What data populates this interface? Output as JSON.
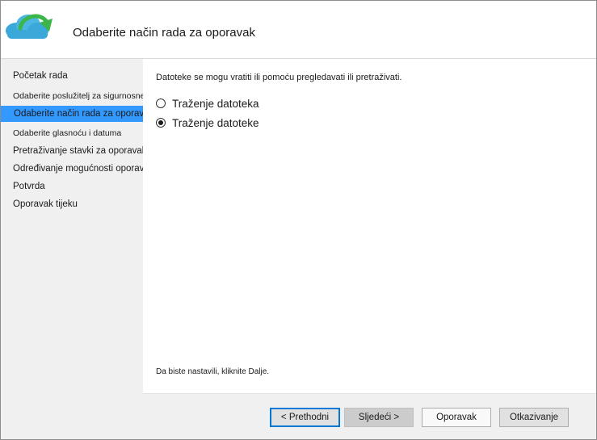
{
  "header": {
    "title": "Odaberite način rada za oporavak",
    "icon": "cloud-recovery-icon",
    "colors": {
      "cloud": "#3aa8d8",
      "arrow": "#3cb54a"
    }
  },
  "sidebar": {
    "items": [
      {
        "label": "Početak rada"
      },
      {
        "label": "Odaberite poslužitelj za sigurnosne kopije"
      },
      {
        "label": "Odaberite način rada za oporavak"
      },
      {
        "label": "Odaberite glasnoću i datuma"
      },
      {
        "label": "Pretraživanje stavki za oporavak"
      },
      {
        "label": "Određivanje mogućnosti oporavka"
      },
      {
        "label": "Potvrda"
      },
      {
        "label": "Oporavak tijeku"
      }
    ],
    "active_index": 2,
    "active_color": "#3399ff"
  },
  "main": {
    "description": "Datoteke se mogu vratiti ili pomoću pregledavati ili pretraživati.",
    "options": [
      {
        "label": "Traženje datoteka",
        "checked": false
      },
      {
        "label": "Traženje datoteke",
        "checked": true
      }
    ],
    "continue_hint": "Da biste nastavili, kliknite Dalje."
  },
  "footer": {
    "back_label": "< Prethodni",
    "next_label": "Sljedeći >",
    "recover_label": "Oporavak",
    "cancel_label": "Otkazivanje"
  }
}
